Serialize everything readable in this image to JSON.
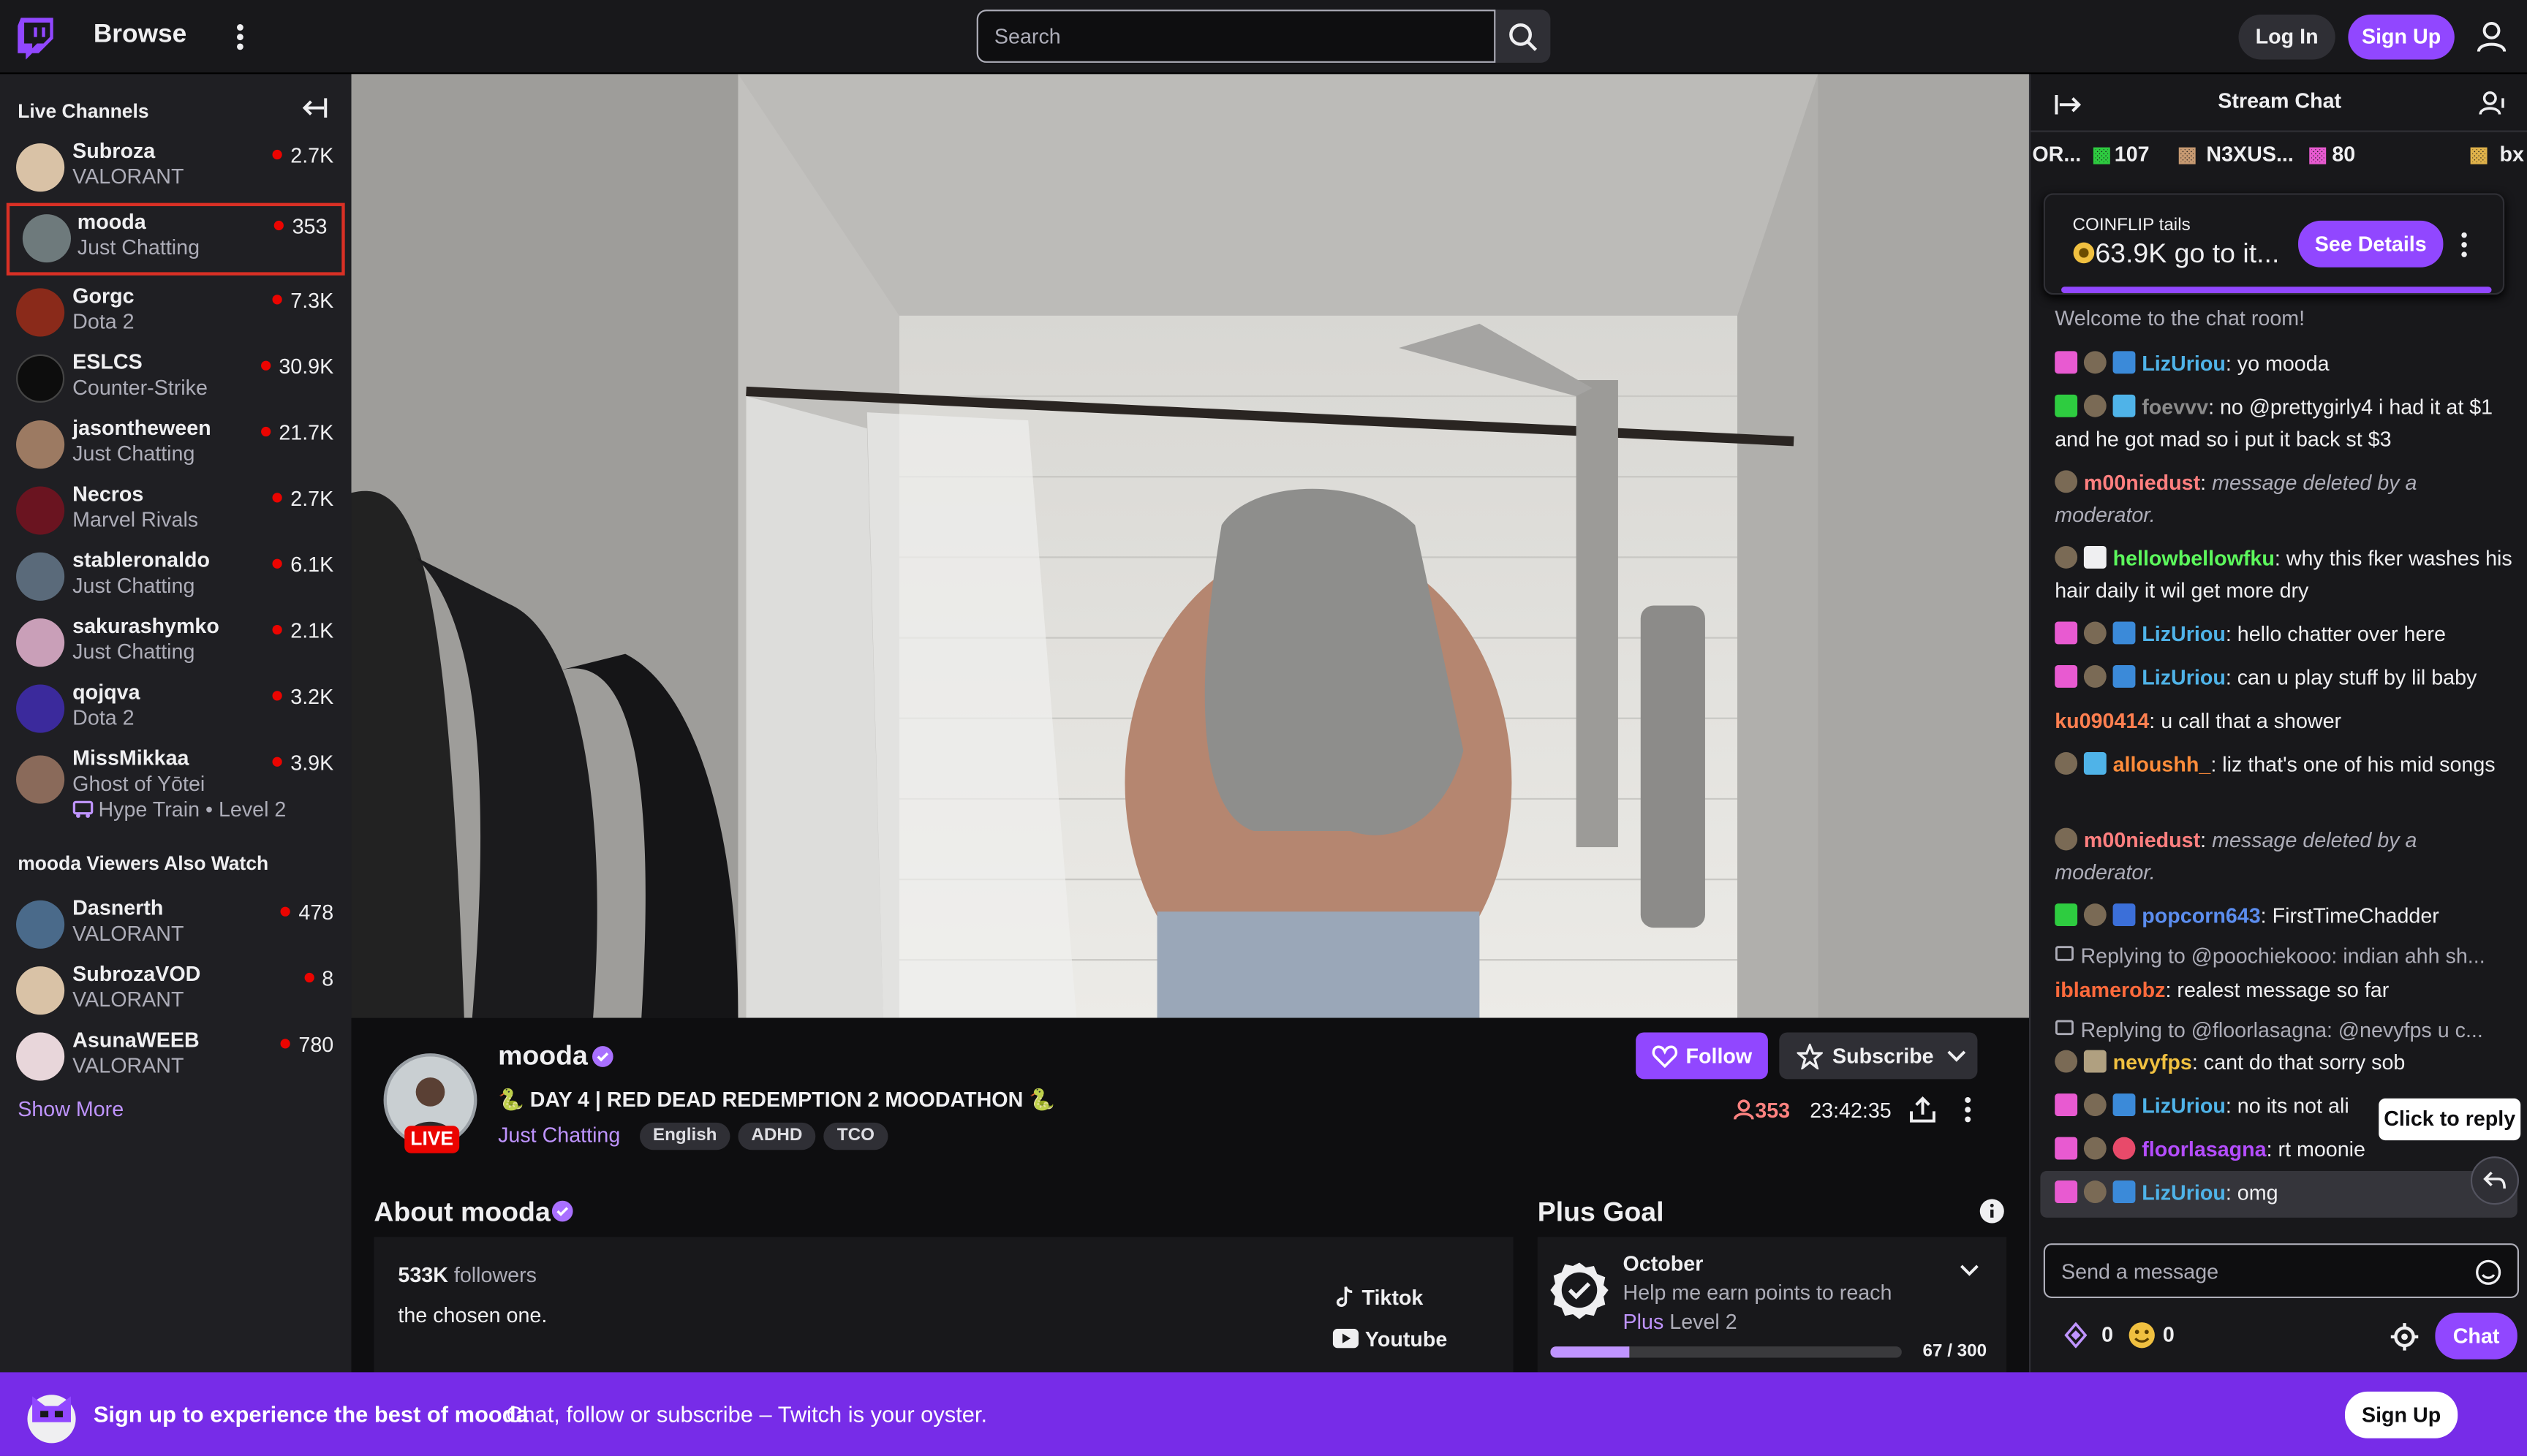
{
  "nav": {
    "browse": "Browse",
    "search_placeholder": "Search",
    "login": "Log In",
    "signup": "Sign Up"
  },
  "sidebar": {
    "live_heading": "Live Channels",
    "channels": [
      {
        "name": "Subroza",
        "game": "VALORANT",
        "viewers": "2.7K"
      },
      {
        "name": "mooda",
        "game": "Just Chatting",
        "viewers": "353"
      },
      {
        "name": "Gorgc",
        "game": "Dota 2",
        "viewers": "7.3K"
      },
      {
        "name": "ESLCS",
        "game": "Counter-Strike",
        "viewers": "30.9K"
      },
      {
        "name": "jasontheween",
        "game": "Just Chatting",
        "viewers": "21.7K"
      },
      {
        "name": "Necros",
        "game": "Marvel Rivals",
        "viewers": "2.7K"
      },
      {
        "name": "stableronaldo",
        "game": "Just Chatting",
        "viewers": "6.1K"
      },
      {
        "name": "sakurashymko",
        "game": "Just Chatting",
        "viewers": "2.1K"
      },
      {
        "name": "qojqva",
        "game": "Dota 2",
        "viewers": "3.2K"
      },
      {
        "name": "MissMikkaa",
        "game": "Ghost of Yōtei",
        "viewers": "3.9K"
      }
    ],
    "hype_train": "Hype Train • Level 2",
    "also_watch_heading": "mooda Viewers Also Watch",
    "also_watch": [
      {
        "name": "Dasnerth",
        "game": "VALORANT",
        "viewers": "478"
      },
      {
        "name": "SubrozaVOD",
        "game": "VALORANT",
        "viewers": "8"
      },
      {
        "name": "AsunaWEEB",
        "game": "VALORANT",
        "viewers": "780"
      }
    ],
    "show_more": "Show More"
  },
  "stream": {
    "live": "LIVE",
    "name": "mooda",
    "title": "🐍 DAY 4 | RED DEAD REDEMPTION 2 MOODATHON 🐍",
    "category": "Just Chatting",
    "tags": [
      "English",
      "ADHD",
      "TCO"
    ],
    "follow": "Follow",
    "subscribe": "Subscribe",
    "viewers": "353",
    "uptime": "23:42:35"
  },
  "about": {
    "title": "About mooda",
    "followers_count": "533K",
    "followers_label": "followers",
    "bio": "the chosen one.",
    "socials": [
      "Tiktok",
      "Youtube"
    ]
  },
  "goal": {
    "title": "Plus Goal",
    "month": "October",
    "desc": "Help me earn points to reach",
    "desc_plus": "Plus",
    "desc_level": "Level 2",
    "count": "67 / 300",
    "progress": 0.223
  },
  "chat": {
    "title": "Stream Chat",
    "gifts": [
      {
        "name": "OR...",
        "count": "107"
      },
      {
        "name": "N3XUS...",
        "count": "80"
      },
      {
        "name": "bx",
        "count": ""
      }
    ],
    "prediction": {
      "label": "COINFLIP tails",
      "value": "63.9K go to it...",
      "button": "See Details"
    },
    "welcome": "Welcome to the chat room!",
    "messages": [
      {
        "user": "LizUriou",
        "color": "#4fb3e8",
        "text": ": yo mooda"
      },
      {
        "user": "foevvv",
        "color": "#8a8a8a",
        "text": ": no @prettygirly4 i had it at $1 and he got mad so i put it back st $3"
      },
      {
        "user": "m00niedust",
        "color": "#ff7f7f",
        "text": ":",
        "deleted": "message deleted by a moderator."
      },
      {
        "user": "hellowbellowfku",
        "color": "#5cf75c",
        "text": ": why this fker washes his hair daily it wil get more dry"
      },
      {
        "user": "LizUriou",
        "color": "#4fb3e8",
        "text": ": hello chatter over here"
      },
      {
        "user": "LizUriou",
        "color": "#4fb3e8",
        "text": ": can u play stuff by lil baby"
      },
      {
        "user": "ku090414",
        "color": "#ff7f50",
        "text": ": u call that a shower"
      },
      {
        "user": "alloushh_",
        "color": "#ff8c3a",
        "text": ": liz that's one of his mid songs"
      },
      {
        "user": "m00niedust",
        "color": "#ff7f7f",
        "text": ":",
        "deleted": "message deleted by a moderator."
      },
      {
        "user": "popcorn643",
        "color": "#5b8def",
        "text": ": FirstTimeChadder"
      },
      {
        "reply": "Replying to @poochiekooo: indian ahh sh...",
        "user": "iblamerobz",
        "color": "#ff6a3c",
        "text": ": realest message so far"
      },
      {
        "reply": "Replying to @floorlasagna: @nevyfps u c...",
        "user": "nevyfps",
        "color": "#f0c040",
        "text": ": cant do that sorry sob"
      },
      {
        "user": "LizUriou",
        "color": "#4fb3e8",
        "text": ": no its not ali"
      },
      {
        "user": "floorlasagna",
        "color": "#b44dff",
        "text": ": rt moonie"
      },
      {
        "user": "LizUriou",
        "color": "#4fb3e8",
        "text": ": omg"
      }
    ],
    "tooltip": "Click to reply",
    "input_placeholder": "Send a message",
    "points_a": "0",
    "points_b": "0",
    "chat_button": "Chat"
  },
  "banner": {
    "bold": "Sign up to experience the best of mooda",
    "text": "Chat, follow or subscribe – Twitch is your oyster.",
    "button": "Sign Up"
  },
  "colors": {
    "accent": "#9147ff",
    "live": "#eb0400",
    "banner": "#772ce8"
  }
}
